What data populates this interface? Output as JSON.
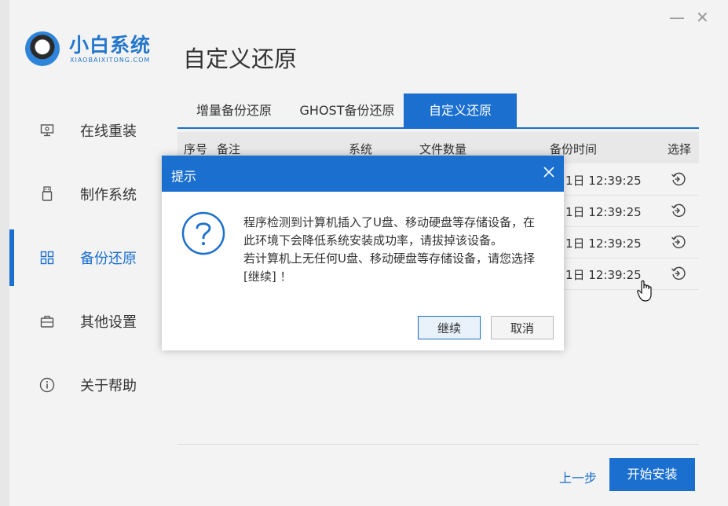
{
  "app": {
    "logo_title": "小白系统",
    "logo_sub": "XIAOBAIXITONG.COM",
    "minimize": "—",
    "close": "✕"
  },
  "page_title": "自定义还原",
  "sidebar": {
    "items": [
      {
        "label": "在线重装",
        "icon": "monitor-icon"
      },
      {
        "label": "制作系统",
        "icon": "usb-icon"
      },
      {
        "label": "备份还原",
        "icon": "grid-icon",
        "active": true
      },
      {
        "label": "其他设置",
        "icon": "briefcase-icon"
      },
      {
        "label": "关于帮助",
        "icon": "info-icon"
      }
    ]
  },
  "tabs": [
    {
      "label": "增量备份还原"
    },
    {
      "label": "GHOST备份还原"
    },
    {
      "label": "自定义还原",
      "active": true
    }
  ],
  "table": {
    "headers": [
      "序号",
      "备注",
      "系统",
      "文件数量",
      "备份时间",
      "选择"
    ],
    "rows": [
      {
        "time": "1日 12:39:25",
        "action_icon": "restore-icon"
      },
      {
        "time": "1日 12:39:25",
        "action_icon": "restore-icon"
      },
      {
        "time": "1日 12:39:25",
        "action_icon": "restore-icon"
      },
      {
        "time": "1日 12:39:25",
        "action_icon": "restore-icon"
      }
    ]
  },
  "footer": {
    "prev_label": "上一步",
    "start_label": "开始安装"
  },
  "dialog": {
    "title": "提示",
    "line1": "程序检测到计算机插入了U盘、移动硬盘等存储设备，在",
    "line2": "此环境下会降低系统安装成功率，请拔掉该设备。",
    "line3": "若计算机上无任何U盘、移动硬盘等存储设备，请您选择",
    "line4": "[继续] ！",
    "continue_label": "继续",
    "cancel_label": "取消"
  },
  "colors": {
    "accent": "#1a6fcf",
    "background": "#f3f3f3",
    "header_row": "#e8e8e8"
  }
}
